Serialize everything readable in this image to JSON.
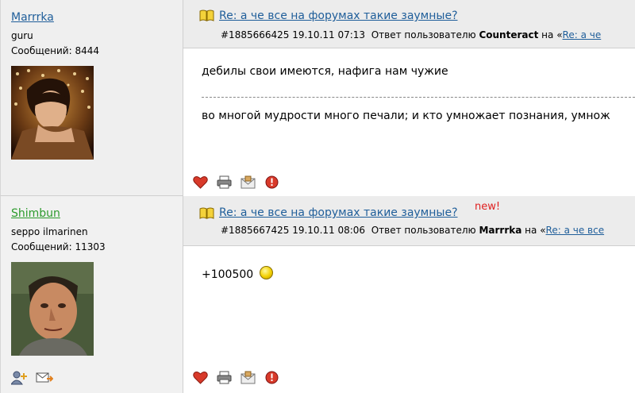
{
  "posts": [
    {
      "user": {
        "name": "Marrrka",
        "title": "guru",
        "count": "Сообщений: 8444"
      },
      "title": "Re: а че все на форумах такие заумные?",
      "new_label": "",
      "meta": {
        "id_date": "#1885666425 19.10.11 07:13",
        "reply_text": "Ответ пользователю",
        "reply_user": "Counteract",
        "on": "на",
        "link_prefix": "«",
        "link": "Re: а че"
      },
      "body_line1": "дебилы свои имеются, нафига нам чужие",
      "signature": "во многой мудрости много печали; и кто умножает познания, умнож"
    },
    {
      "user": {
        "name": "Shimbun",
        "title": "seppo ilmarinen",
        "count": "Сообщений: 11303"
      },
      "title": "Re: а че все на форумах такие заумные?",
      "new_label": "new!",
      "meta": {
        "id_date": "#1885667425 19.10.11 08:06",
        "reply_text": "Ответ пользователю",
        "reply_user": "Marrrka",
        "on": "на",
        "link_prefix": "«",
        "link": "Re: а че все"
      },
      "body_line1": "+100500",
      "signature": ""
    }
  ],
  "icons": {
    "like": "heart-icon",
    "print": "printer-icon",
    "mail": "envelope-icon",
    "report": "warning-icon",
    "add_friend": "add-user-icon",
    "send_message": "send-mail-icon",
    "book": "book-icon",
    "smiley": "smiley-icon"
  },
  "colors": {
    "link": "#1f5e9a",
    "user_online": "#2c9a2c",
    "new": "#e02020"
  }
}
